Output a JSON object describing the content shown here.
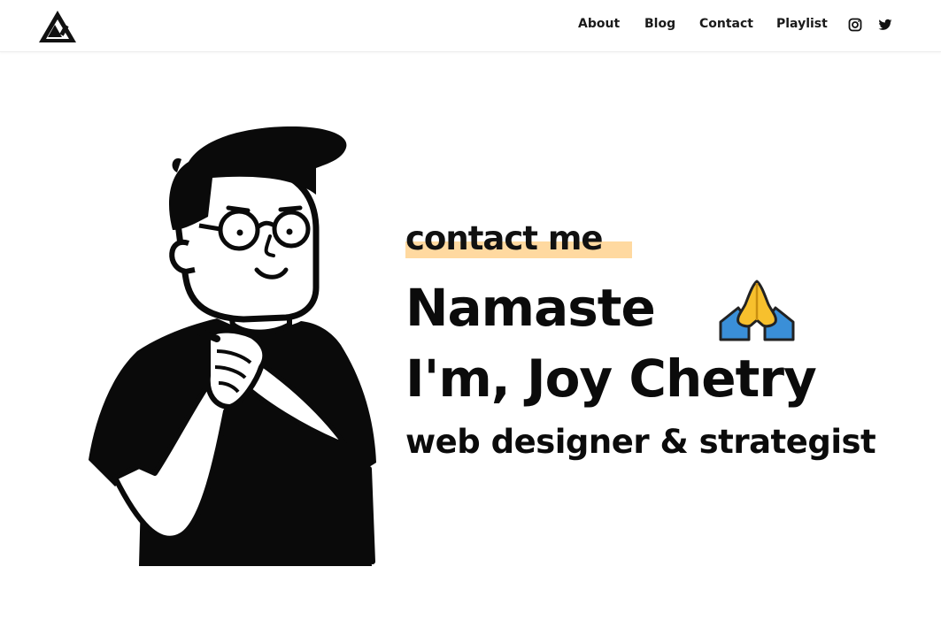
{
  "nav": {
    "links": [
      "About",
      "Blog",
      "Contact",
      "Playlist"
    ],
    "social": [
      "instagram-icon",
      "twitter-icon"
    ]
  },
  "hero": {
    "tag": "contact me",
    "line1": "Namaste",
    "line2": "I'm, Joy Chetry",
    "line3": "web designer & strategist"
  },
  "colors": {
    "highlight": "#ffd9a0",
    "text": "#111111",
    "emoji_hands": "#f7c02d",
    "emoji_sleeves": "#3a8fd8"
  }
}
